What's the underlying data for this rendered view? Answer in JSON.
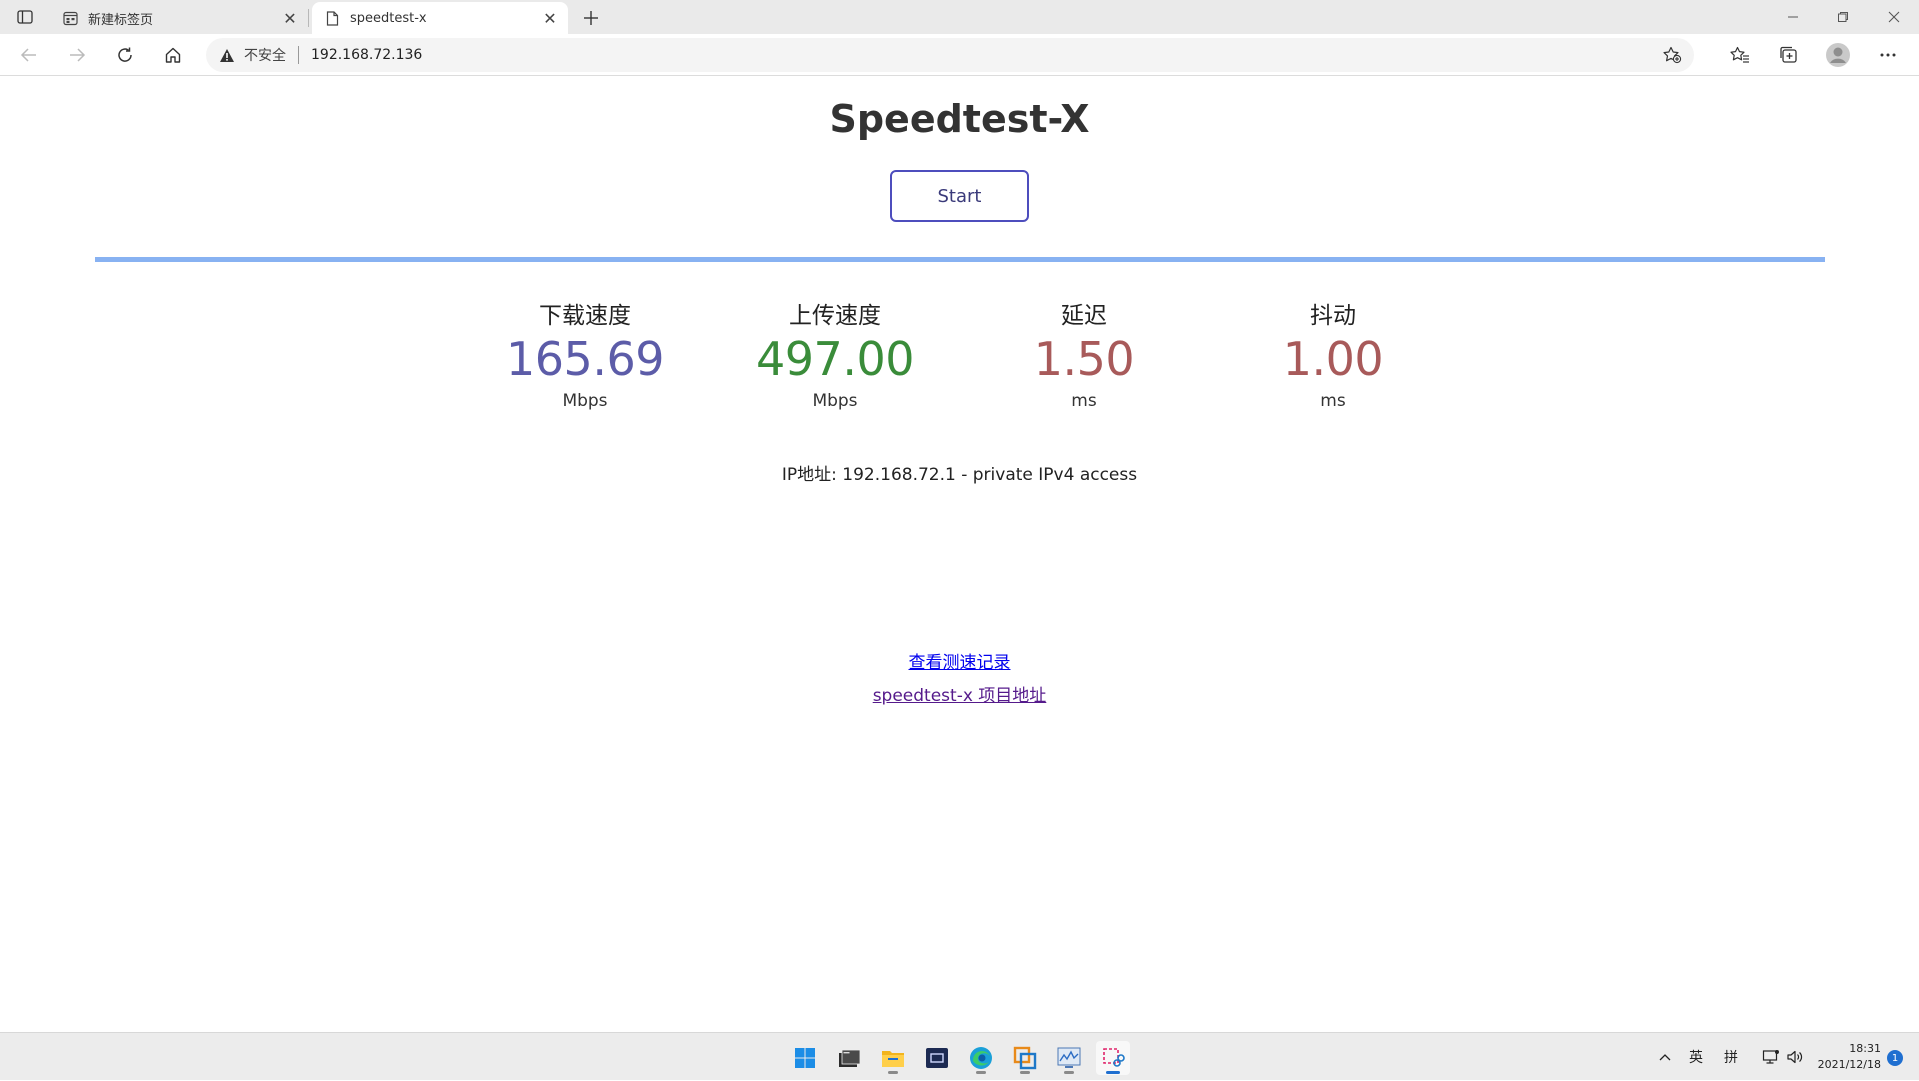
{
  "browser": {
    "tabs": [
      {
        "title": "新建标签页",
        "icon": "new-tab-page-icon",
        "active": false
      },
      {
        "title": "speedtest-x",
        "icon": "document-icon",
        "active": true
      }
    ],
    "address": {
      "security_label": "不安全",
      "url": "192.168.72.136"
    }
  },
  "page": {
    "title": "Speedtest-X",
    "start_label": "Start",
    "progress": 1.0,
    "progress_color": "#88b2f2",
    "metrics": [
      {
        "label": "下载速度",
        "value": "165.69",
        "unit": "Mbps",
        "color": "#5c5ca8"
      },
      {
        "label": "上传速度",
        "value": "497.00",
        "unit": "Mbps",
        "color": "#3a8c3a"
      },
      {
        "label": "延迟",
        "value": "1.50",
        "unit": "ms",
        "color": "#a85a5a"
      },
      {
        "label": "抖动",
        "value": "1.00",
        "unit": "ms",
        "color": "#a85a5a"
      }
    ],
    "ip_info": "IP地址: 192.168.72.1 - private IPv4 access",
    "links": {
      "history": "查看测速记录",
      "project": "speedtest-x 项目地址"
    }
  },
  "taskbar": {
    "apps": [
      "windows-start-icon",
      "terminal-icon",
      "file-explorer-icon",
      "remote-desktop-icon",
      "edge-browser-icon",
      "vmware-icon",
      "resource-monitor-icon",
      "snipping-tool-icon"
    ],
    "tray": {
      "ime_language": "英",
      "ime_mode": "拼",
      "time": "18:31",
      "date": "2021/12/18",
      "notification_count": "1"
    }
  }
}
